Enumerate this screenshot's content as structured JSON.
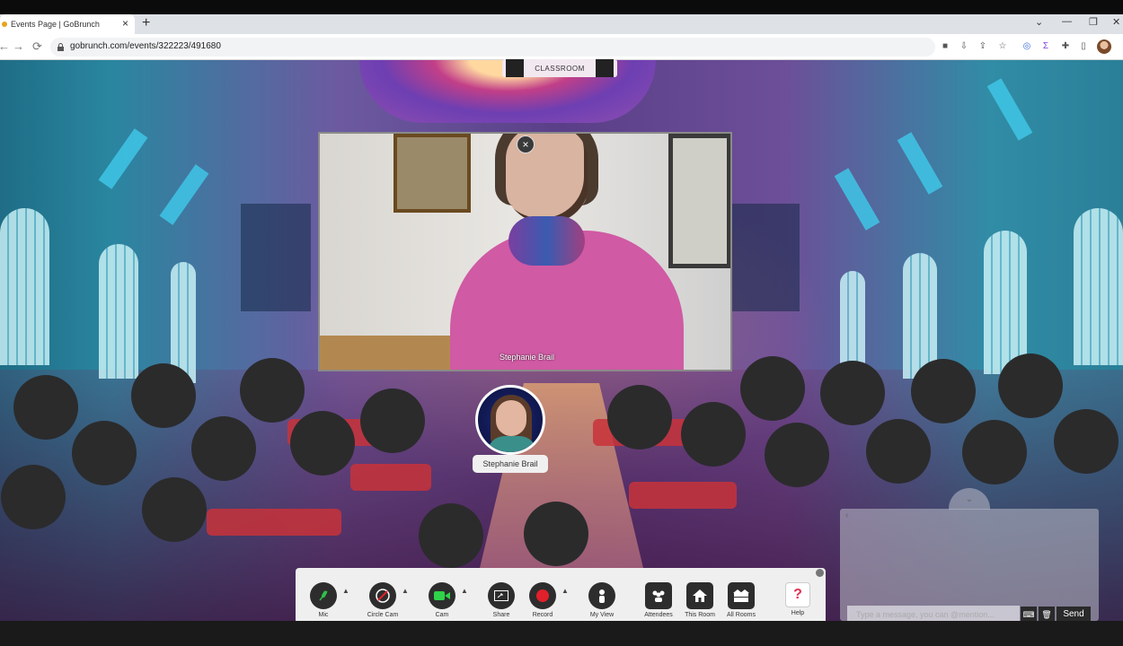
{
  "browser": {
    "tab_title": "Events Page | GoBrunch",
    "tab_close": "×",
    "new_tab": "+",
    "url": "gobrunch.com/events/322223/491680",
    "window_controls": [
      "⌄",
      "—",
      "❐",
      "✕"
    ],
    "nav_icons": [
      "←",
      "→",
      "⟳"
    ],
    "extension_icons": [
      "camera-icon",
      "install-icon",
      "share-icon",
      "star-icon",
      "extension-icon",
      "sigma-icon",
      "puzzle-icon",
      "sidepanel-icon"
    ]
  },
  "room": {
    "label": "CLASSROOM"
  },
  "video": {
    "name": "Stephanie Brail",
    "close": "×"
  },
  "presenter": {
    "name": "Stephanie Brail"
  },
  "chat": {
    "toggle": "⌄",
    "back": "‹",
    "placeholder": "Type a message, you can @mention...",
    "send": "Send"
  },
  "toolbar": {
    "mic": "Mic",
    "circle_cam": "Circle Cam",
    "cam": "Cam",
    "share": "Share",
    "record": "Record",
    "my_view": "My View",
    "attendees": "Attendees",
    "this_room": "This Room",
    "all_rooms": "All Rooms",
    "help": "Help",
    "help_glyph": "?",
    "caret": "▲"
  },
  "colors": {
    "mic_accent": "#2fbf4a",
    "cam_accent": "#2fd24a",
    "record_accent": "#e0202a",
    "help_accent": "#e03050",
    "seat": "#2b2b2c"
  }
}
